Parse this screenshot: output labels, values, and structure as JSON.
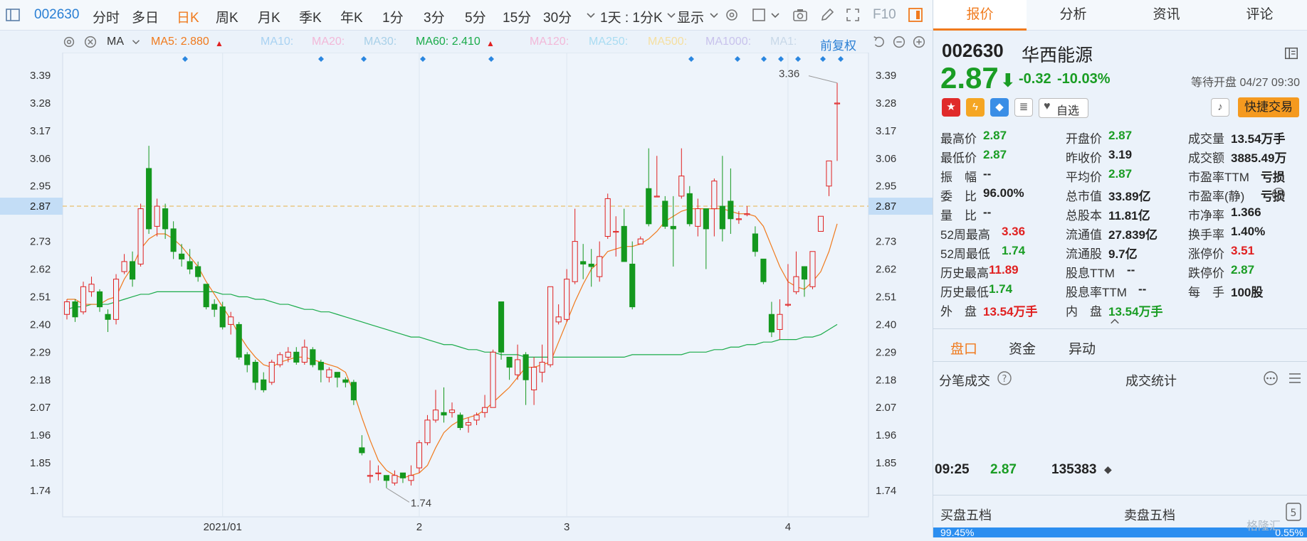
{
  "toolbar": {
    "code": "002630",
    "periods": [
      "分时",
      "多日",
      "日K",
      "周K",
      "月K",
      "季K",
      "年K",
      "1分",
      "3分",
      "5分",
      "15分",
      "30分"
    ],
    "active_period": "日K",
    "interval": "1天 : 1分K",
    "display": "显示",
    "f10": "F10"
  },
  "ma_legend": {
    "indicator": "MA",
    "items": [
      {
        "label": "MA5: 2.880",
        "color": "#f07a1d",
        "arrow": "▲"
      },
      {
        "label": "MA10:",
        "color": "#a9d2f2"
      },
      {
        "label": "MA20:",
        "color": "#f2b8d8"
      },
      {
        "label": "MA30:",
        "color": "#a8d0e8"
      },
      {
        "label": "MA60: 2.410",
        "color": "#1aab4a",
        "arrow": "▲"
      },
      {
        "label": "MA120:",
        "color": "#f2b8d8"
      },
      {
        "label": "MA250:",
        "color": "#a9dcf2"
      },
      {
        "label": "MA500:",
        "color": "#f5dfa0"
      },
      {
        "label": "MA1000:",
        "color": "#c8c2ec"
      },
      {
        "label": "MA1:",
        "color": "#c8d8e8"
      }
    ],
    "adjust": "前复权"
  },
  "chart_data": {
    "type": "candlestick",
    "y_ticks": [
      "3.39",
      "3.28",
      "3.17",
      "3.06",
      "2.95",
      "2.87",
      "2.73",
      "2.62",
      "2.51",
      "2.40",
      "2.29",
      "2.18",
      "2.07",
      "1.96",
      "1.85",
      "1.74"
    ],
    "ylim": [
      1.7,
      3.45
    ],
    "current_price": "2.87",
    "x_labels": [
      "2021/01",
      "2",
      "3",
      "4"
    ],
    "annotations": {
      "high": "3.36",
      "low": "1.74"
    },
    "candles": [
      [
        2.44,
        2.49,
        2.42,
        2.5
      ],
      [
        2.49,
        2.43,
        2.41,
        2.5
      ],
      [
        2.45,
        2.55,
        2.44,
        2.57
      ],
      [
        2.53,
        2.56,
        2.51,
        2.59
      ],
      [
        2.53,
        2.47,
        2.45,
        2.54
      ],
      [
        2.44,
        2.42,
        2.37,
        2.46
      ],
      [
        2.42,
        2.58,
        2.4,
        2.6
      ],
      [
        2.61,
        2.65,
        2.6,
        2.68
      ],
      [
        2.65,
        2.58,
        2.55,
        2.69
      ],
      [
        2.64,
        2.86,
        2.63,
        2.88
      ],
      [
        3.02,
        2.78,
        2.76,
        3.11
      ],
      [
        2.79,
        2.87,
        2.75,
        2.9
      ],
      [
        2.86,
        2.78,
        2.74,
        2.88
      ],
      [
        2.78,
        2.69,
        2.66,
        2.81
      ],
      [
        2.68,
        2.66,
        2.63,
        2.72
      ],
      [
        2.65,
        2.62,
        2.6,
        2.7
      ],
      [
        2.63,
        2.59,
        2.57,
        2.65
      ],
      [
        2.56,
        2.47,
        2.46,
        2.56
      ],
      [
        2.48,
        2.46,
        2.43,
        2.5
      ],
      [
        2.47,
        2.39,
        2.38,
        2.49
      ],
      [
        2.4,
        2.43,
        2.36,
        2.45
      ],
      [
        2.4,
        2.27,
        2.26,
        2.41
      ],
      [
        2.28,
        2.24,
        2.21,
        2.29
      ],
      [
        2.25,
        2.17,
        2.14,
        2.26
      ],
      [
        2.18,
        2.14,
        2.13,
        2.21
      ],
      [
        2.17,
        2.25,
        2.16,
        2.26
      ],
      [
        2.24,
        2.28,
        2.23,
        2.29
      ],
      [
        2.27,
        2.29,
        2.25,
        2.31
      ],
      [
        2.29,
        2.25,
        2.24,
        2.31
      ],
      [
        2.25,
        2.31,
        2.24,
        2.34
      ],
      [
        2.3,
        2.24,
        2.23,
        2.31
      ],
      [
        2.25,
        2.22,
        2.17,
        2.26
      ],
      [
        2.19,
        2.22,
        2.17,
        2.23
      ],
      [
        2.21,
        2.19,
        2.15,
        2.21
      ],
      [
        2.18,
        2.17,
        2.15,
        2.19
      ],
      [
        2.17,
        2.1,
        2.08,
        2.18
      ],
      [
        1.91,
        1.89,
        1.88,
        1.96
      ],
      [
        1.8,
        1.8,
        1.77,
        1.86
      ],
      [
        1.81,
        1.81,
        1.78,
        1.84
      ],
      [
        1.8,
        1.78,
        1.75,
        1.8
      ],
      [
        1.77,
        1.8,
        1.76,
        1.82
      ],
      [
        1.81,
        1.79,
        1.77,
        1.81
      ],
      [
        1.78,
        1.8,
        1.76,
        1.84
      ],
      [
        1.83,
        1.93,
        1.81,
        1.94
      ],
      [
        1.93,
        2.02,
        1.92,
        2.04
      ],
      [
        2.02,
        2.06,
        2.01,
        2.14
      ],
      [
        2.05,
        2.04,
        2.01,
        2.15
      ],
      [
        2.05,
        2.06,
        2.03,
        2.09
      ],
      [
        2.04,
        1.99,
        1.98,
        2.05
      ],
      [
        2.0,
        2.01,
        1.97,
        2.03
      ],
      [
        2.02,
        2.04,
        2.0,
        2.05
      ],
      [
        2.05,
        2.07,
        2.03,
        2.12
      ],
      [
        2.07,
        2.29,
        2.07,
        2.3
      ],
      [
        2.49,
        2.29,
        2.26,
        2.49
      ],
      [
        2.27,
        2.23,
        2.18,
        2.27
      ],
      [
        2.2,
        2.26,
        2.18,
        2.32
      ],
      [
        2.28,
        2.18,
        2.08,
        2.29
      ],
      [
        2.14,
        2.23,
        2.08,
        2.27
      ],
      [
        2.21,
        2.25,
        2.17,
        2.32
      ],
      [
        2.24,
        2.55,
        2.23,
        2.55
      ],
      [
        2.41,
        2.43,
        2.4,
        2.48
      ],
      [
        2.42,
        2.58,
        2.41,
        2.62
      ],
      [
        2.57,
        2.73,
        2.56,
        2.86
      ],
      [
        2.65,
        2.64,
        2.58,
        2.72
      ],
      [
        2.64,
        2.63,
        2.55,
        2.7
      ],
      [
        2.59,
        2.67,
        2.57,
        2.73
      ],
      [
        2.75,
        2.9,
        2.74,
        2.92
      ],
      [
        2.77,
        2.77,
        2.67,
        2.83
      ],
      [
        2.79,
        2.65,
        2.65,
        2.86
      ],
      [
        2.64,
        2.47,
        2.46,
        2.73
      ],
      [
        2.72,
        2.74,
        2.73,
        2.75
      ],
      [
        2.94,
        2.8,
        2.79,
        3.1
      ],
      [
        2.91,
        2.91,
        2.91,
        3.07
      ],
      [
        2.89,
        2.79,
        2.78,
        2.91
      ],
      [
        2.79,
        2.78,
        2.63,
        2.91
      ],
      [
        2.91,
        2.99,
        2.9,
        3.1
      ],
      [
        2.92,
        2.8,
        2.79,
        2.95
      ],
      [
        2.79,
        2.86,
        2.75,
        2.9
      ],
      [
        2.86,
        2.78,
        2.62,
        2.85
      ],
      [
        2.86,
        2.97,
        2.75,
        2.98
      ],
      [
        2.87,
        2.78,
        2.73,
        3.07
      ],
      [
        2.89,
        2.82,
        2.76,
        3.02
      ],
      [
        2.82,
        2.82,
        2.8,
        2.85
      ],
      [
        2.84,
        2.84,
        2.83,
        2.87
      ],
      [
        2.76,
        2.69,
        2.67,
        2.79
      ],
      [
        2.66,
        2.57,
        2.56,
        2.66
      ],
      [
        2.44,
        2.37,
        2.35,
        2.49
      ],
      [
        2.38,
        2.44,
        2.34,
        2.5
      ],
      [
        2.48,
        2.48,
        2.47,
        2.64
      ],
      [
        2.53,
        2.59,
        2.52,
        2.69
      ],
      [
        2.63,
        2.58,
        2.51,
        2.63
      ],
      [
        2.55,
        2.69,
        2.54,
        2.69
      ],
      [
        2.77,
        2.83,
        2.77,
        2.83
      ],
      [
        2.95,
        3.05,
        2.91,
        3.05
      ],
      [
        3.28,
        3.28,
        3.05,
        3.36
      ]
    ],
    "ma5": [
      2.5,
      2.5,
      2.48,
      2.48,
      2.48,
      2.5,
      2.51,
      2.58,
      2.63,
      2.7,
      2.74,
      2.76,
      2.76,
      2.74,
      2.71,
      2.67,
      2.63,
      2.57,
      2.52,
      2.47,
      2.42,
      2.36,
      2.31,
      2.27,
      2.24,
      2.23,
      2.25,
      2.26,
      2.27,
      2.27,
      2.26,
      2.25,
      2.24,
      2.23,
      2.21,
      2.13,
      2.03,
      1.94,
      1.86,
      1.82,
      1.8,
      1.79,
      1.8,
      1.81,
      1.84,
      1.91,
      1.97,
      2.0,
      2.02,
      2.03,
      2.04,
      2.06,
      2.09,
      2.12,
      2.15,
      2.19,
      2.23,
      2.23,
      2.24,
      2.25,
      2.33,
      2.41,
      2.49,
      2.56,
      2.62,
      2.65,
      2.69,
      2.7,
      2.71,
      2.71,
      2.72,
      2.74,
      2.77,
      2.81,
      2.83,
      2.85,
      2.86,
      2.86,
      2.86,
      2.86,
      2.86,
      2.85,
      2.84,
      2.84,
      2.83,
      2.79,
      2.71,
      2.63,
      2.57,
      2.55,
      2.54,
      2.57,
      2.61,
      2.69,
      2.8
    ],
    "ma60": [
      2.46,
      2.47,
      2.47,
      2.48,
      2.48,
      2.48,
      2.49,
      2.5,
      2.51,
      2.52,
      2.52,
      2.53,
      2.53,
      2.53,
      2.53,
      2.53,
      2.53,
      2.53,
      2.53,
      2.52,
      2.52,
      2.51,
      2.51,
      2.5,
      2.5,
      2.49,
      2.48,
      2.48,
      2.47,
      2.46,
      2.46,
      2.45,
      2.45,
      2.44,
      2.43,
      2.42,
      2.41,
      2.4,
      2.39,
      2.38,
      2.37,
      2.36,
      2.35,
      2.35,
      2.34,
      2.33,
      2.32,
      2.32,
      2.31,
      2.3,
      2.3,
      2.29,
      2.29,
      2.28,
      2.28,
      2.28,
      2.27,
      2.27,
      2.27,
      2.27,
      2.27,
      2.27,
      2.27,
      2.27,
      2.27,
      2.27,
      2.27,
      2.27,
      2.27,
      2.28,
      2.28,
      2.28,
      2.28,
      2.28,
      2.28,
      2.28,
      2.29,
      2.29,
      2.29,
      2.3,
      2.3,
      2.31,
      2.31,
      2.32,
      2.32,
      2.33,
      2.33,
      2.34,
      2.34,
      2.34,
      2.35,
      2.35,
      2.36,
      2.38,
      2.4
    ]
  },
  "panel": {
    "tabs": [
      "报价",
      "分析",
      "资讯",
      "评论"
    ],
    "code": "002630",
    "name": "华西能源",
    "price": "2.87",
    "arrow": "⬇",
    "change": "-0.32",
    "change_pct": "-10.03%",
    "status": "等待开盘 04/27 09:30",
    "watch": "自选",
    "quick_trade": "快捷交易",
    "quote": [
      {
        "label": "最高价",
        "value": "2.87",
        "cls": "green"
      },
      {
        "label": "开盘价",
        "value": "2.87",
        "cls": "green"
      },
      {
        "label": "成交量",
        "value": "13.54万手",
        "cls": ""
      },
      {
        "label": "最低价",
        "value": "2.87",
        "cls": "green"
      },
      {
        "label": "昨收价",
        "value": "3.19",
        "cls": ""
      },
      {
        "label": "成交额",
        "value": "3885.49万",
        "cls": ""
      },
      {
        "label": "振　幅",
        "value": "--",
        "cls": ""
      },
      {
        "label": "平均价",
        "value": "2.87",
        "cls": "green"
      },
      {
        "label": "市盈率TTM",
        "value": "亏损",
        "cls": ""
      },
      {
        "label": "委　比",
        "value": "96.00%",
        "cls": ""
      },
      {
        "label": "总市值",
        "value": "33.89亿",
        "cls": ""
      },
      {
        "label": "市盈率(静)",
        "value": "亏损",
        "cls": ""
      },
      {
        "label": "量　比",
        "value": "--",
        "cls": ""
      },
      {
        "label": "总股本",
        "value": "11.81亿",
        "cls": ""
      },
      {
        "label": "市净率",
        "value": "1.366",
        "cls": ""
      },
      {
        "label": "52周最高",
        "value": "3.36",
        "cls": "red"
      },
      {
        "label": "流通值",
        "value": "27.839亿",
        "cls": ""
      },
      {
        "label": "换手率",
        "value": "1.40%",
        "cls": ""
      },
      {
        "label": "52周最低",
        "value": "1.74",
        "cls": "green"
      },
      {
        "label": "流通股",
        "value": "9.7亿",
        "cls": ""
      },
      {
        "label": "涨停价",
        "value": "3.51",
        "cls": "red"
      },
      {
        "label": "历史最高",
        "value": "11.89",
        "cls": "red"
      },
      {
        "label": "股息TTM",
        "value": "--",
        "cls": ""
      },
      {
        "label": "跌停价",
        "value": "2.87",
        "cls": "green"
      },
      {
        "label": "历史最低",
        "value": "1.74",
        "cls": "green"
      },
      {
        "label": "股息率TTM",
        "value": "--",
        "cls": ""
      },
      {
        "label": "每　手",
        "value": "100股",
        "cls": ""
      },
      {
        "label": "外　盘",
        "value": "13.54万手",
        "cls": "red"
      },
      {
        "label": "内　盘",
        "value": "13.54万手",
        "cls": "green"
      }
    ],
    "subtabs": [
      "盘口",
      "资金",
      "异动"
    ],
    "tick_title": "分笔成交",
    "tick_stats": "统计",
    "tick_stats_prefix": "成交",
    "tick": {
      "time": "09:25",
      "price": "2.87",
      "volume": "135383"
    },
    "order_buy": "买盘五档",
    "order_sell": "卖盘五档",
    "bar_left": "99.45%",
    "bar_right": "0.55%",
    "watermark": "格隆汇"
  }
}
